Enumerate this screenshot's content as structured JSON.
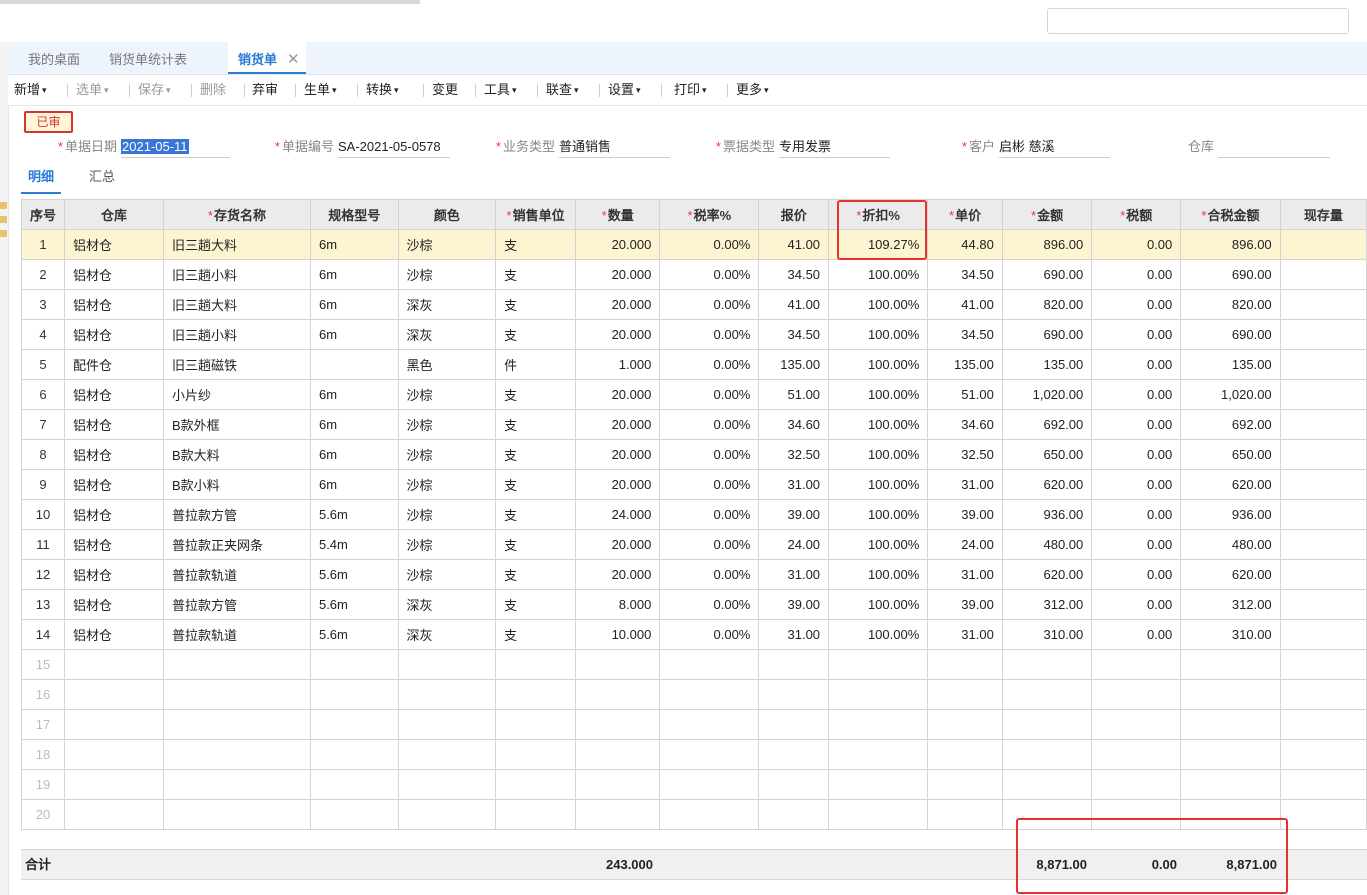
{
  "tabs": [
    "我的桌面",
    "销货单统计表",
    "销货单"
  ],
  "toolbar": [
    {
      "label": "新增",
      "caret": true,
      "disabled": false
    },
    {
      "label": "选单",
      "caret": true,
      "disabled": true
    },
    {
      "label": "保存",
      "caret": true,
      "disabled": true
    },
    {
      "label": "删除",
      "caret": false,
      "disabled": true
    },
    {
      "label": "弃审",
      "caret": false,
      "disabled": false
    },
    {
      "label": "生单",
      "caret": true,
      "disabled": false
    },
    {
      "label": "转换",
      "caret": true,
      "disabled": false
    },
    {
      "label": "变更",
      "caret": false,
      "disabled": false
    },
    {
      "label": "工具",
      "caret": true,
      "disabled": false
    },
    {
      "label": "联查",
      "caret": true,
      "disabled": false
    },
    {
      "label": "设置",
      "caret": true,
      "disabled": false
    },
    {
      "label": "打印",
      "caret": true,
      "disabled": false
    },
    {
      "label": "更多",
      "caret": true,
      "disabled": false
    }
  ],
  "status_stamp": "已审",
  "fields": {
    "date": {
      "label": "单据日期",
      "value": "2021-05-11"
    },
    "number": {
      "label": "单据编号",
      "value": "SA-2021-05-0578"
    },
    "business_type": {
      "label": "业务类型",
      "value": "普通销售"
    },
    "invoice_type": {
      "label": "票据类型",
      "value": "专用发票"
    },
    "customer": {
      "label": "客户",
      "value": "启彬 慈溪"
    },
    "warehouse": {
      "label": "仓库",
      "value": ""
    }
  },
  "subtabs": [
    "明细",
    "汇总"
  ],
  "columns": [
    {
      "label": "序号",
      "required": false
    },
    {
      "label": "仓库",
      "required": false
    },
    {
      "label": "存货名称",
      "required": true
    },
    {
      "label": "规格型号",
      "required": false
    },
    {
      "label": "颜色",
      "required": false
    },
    {
      "label": "销售单位",
      "required": true
    },
    {
      "label": "数量",
      "required": true
    },
    {
      "label": "税率%",
      "required": true
    },
    {
      "label": "报价",
      "required": false
    },
    {
      "label": "折扣%",
      "required": true
    },
    {
      "label": "单价",
      "required": true
    },
    {
      "label": "金额",
      "required": true
    },
    {
      "label": "税额",
      "required": true
    },
    {
      "label": "合税金额",
      "required": true
    },
    {
      "label": "现存量",
      "required": false
    }
  ],
  "rows": [
    [
      "1",
      "铝材仓",
      "旧三趟大料",
      "6m",
      "沙棕",
      "支",
      "20.000",
      "0.00%",
      "41.00",
      "109.27%",
      "44.80",
      "896.00",
      "0.00",
      "896.00",
      ""
    ],
    [
      "2",
      "铝材仓",
      "旧三趟小料",
      "6m",
      "沙棕",
      "支",
      "20.000",
      "0.00%",
      "34.50",
      "100.00%",
      "34.50",
      "690.00",
      "0.00",
      "690.00",
      ""
    ],
    [
      "3",
      "铝材仓",
      "旧三趟大料",
      "6m",
      "深灰",
      "支",
      "20.000",
      "0.00%",
      "41.00",
      "100.00%",
      "41.00",
      "820.00",
      "0.00",
      "820.00",
      ""
    ],
    [
      "4",
      "铝材仓",
      "旧三趟小料",
      "6m",
      "深灰",
      "支",
      "20.000",
      "0.00%",
      "34.50",
      "100.00%",
      "34.50",
      "690.00",
      "0.00",
      "690.00",
      ""
    ],
    [
      "5",
      "配件仓",
      "旧三趟磁铁",
      "",
      "黑色",
      "件",
      "1.000",
      "0.00%",
      "135.00",
      "100.00%",
      "135.00",
      "135.00",
      "0.00",
      "135.00",
      ""
    ],
    [
      "6",
      "铝材仓",
      "小片纱",
      "6m",
      "沙棕",
      "支",
      "20.000",
      "0.00%",
      "51.00",
      "100.00%",
      "51.00",
      "1,020.00",
      "0.00",
      "1,020.00",
      ""
    ],
    [
      "7",
      "铝材仓",
      "B款外框",
      "6m",
      "沙棕",
      "支",
      "20.000",
      "0.00%",
      "34.60",
      "100.00%",
      "34.60",
      "692.00",
      "0.00",
      "692.00",
      ""
    ],
    [
      "8",
      "铝材仓",
      "B款大料",
      "6m",
      "沙棕",
      "支",
      "20.000",
      "0.00%",
      "32.50",
      "100.00%",
      "32.50",
      "650.00",
      "0.00",
      "650.00",
      ""
    ],
    [
      "9",
      "铝材仓",
      "B款小料",
      "6m",
      "沙棕",
      "支",
      "20.000",
      "0.00%",
      "31.00",
      "100.00%",
      "31.00",
      "620.00",
      "0.00",
      "620.00",
      ""
    ],
    [
      "10",
      "铝材仓",
      "普拉款方管",
      "5.6m",
      "沙棕",
      "支",
      "24.000",
      "0.00%",
      "39.00",
      "100.00%",
      "39.00",
      "936.00",
      "0.00",
      "936.00",
      ""
    ],
    [
      "11",
      "铝材仓",
      "普拉款正夹网条",
      "5.4m",
      "沙棕",
      "支",
      "20.000",
      "0.00%",
      "24.00",
      "100.00%",
      "24.00",
      "480.00",
      "0.00",
      "480.00",
      ""
    ],
    [
      "12",
      "铝材仓",
      "普拉款轨道",
      "5.6m",
      "沙棕",
      "支",
      "20.000",
      "0.00%",
      "31.00",
      "100.00%",
      "31.00",
      "620.00",
      "0.00",
      "620.00",
      ""
    ],
    [
      "13",
      "铝材仓",
      "普拉款方管",
      "5.6m",
      "深灰",
      "支",
      "8.000",
      "0.00%",
      "39.00",
      "100.00%",
      "39.00",
      "312.00",
      "0.00",
      "312.00",
      ""
    ],
    [
      "14",
      "铝材仓",
      "普拉款轨道",
      "5.6m",
      "深灰",
      "支",
      "10.000",
      "0.00%",
      "31.00",
      "100.00%",
      "31.00",
      "310.00",
      "0.00",
      "310.00",
      ""
    ]
  ],
  "empty_rows": [
    "15",
    "16",
    "17",
    "18",
    "19",
    "20"
  ],
  "totals": {
    "label": "合计",
    "quantity": "243.000",
    "amount": "8,871.00",
    "tax": "0.00",
    "total_with_tax": "8,871.00"
  },
  "colors": {
    "accent": "#2b7bd4",
    "highlight_border": "#e8312a",
    "selected_row": "#fdf5d1",
    "required_mark": "#e34"
  }
}
